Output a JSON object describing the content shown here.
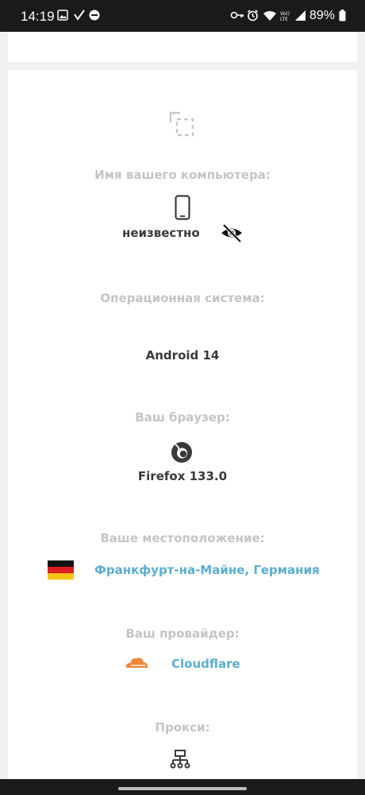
{
  "status_bar": {
    "time": "14:19",
    "battery": "89%"
  },
  "computer_name": {
    "label": "Имя вашего компьютера:",
    "value": "неизвестно",
    "device_icon": "smartphone-icon",
    "toggle_icon": "eye-slash-icon"
  },
  "os": {
    "label": "Операционная система:",
    "value": "Android 14"
  },
  "browser": {
    "label": "Ваш браузер:",
    "value": "Firefox 133.0",
    "icon": "firefox-icon"
  },
  "location": {
    "label": "Ваше местоположение:",
    "value": "Франкфурт-на-Майне, Германия",
    "icon": "germany-flag-icon"
  },
  "provider": {
    "label": "Ваш провайдер:",
    "value": "Cloudflare",
    "icon": "cloudflare-icon"
  },
  "proxy": {
    "label": "Прокси:",
    "icon": "network-icon"
  },
  "colors": {
    "label": "#c4c4c4",
    "value": "#3a3a3a",
    "link": "#5aaecf",
    "cloudflare": "#f0883a"
  }
}
